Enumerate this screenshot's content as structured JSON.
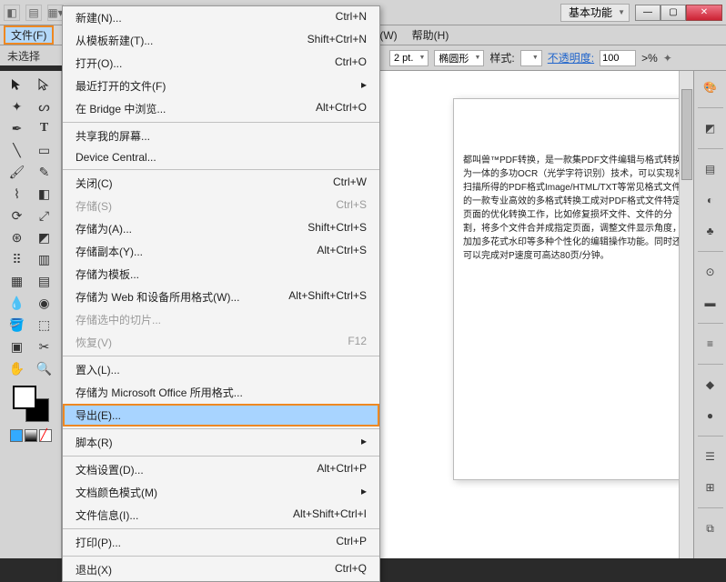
{
  "toprow": {
    "workspace": "基本功能"
  },
  "menubar": {
    "file": "文件(F)",
    "window": "(W)",
    "help": "帮助(H)"
  },
  "no_selection": "未选择",
  "ctrlbar": {
    "stroke_val": "2 pt.",
    "stroke_style": "椭圆形",
    "style_label": "样式:",
    "opacity_label": "不透明度:",
    "opacity_val": "100",
    "pct": ">%"
  },
  "menu": {
    "new": "新建(N)...",
    "new_sc": "Ctrl+N",
    "new_tpl": "从模板新建(T)...",
    "new_tpl_sc": "Shift+Ctrl+N",
    "open": "打开(O)...",
    "open_sc": "Ctrl+O",
    "recent": "最近打开的文件(F)",
    "bridge": "在 Bridge 中浏览...",
    "bridge_sc": "Alt+Ctrl+O",
    "share": "共享我的屏幕...",
    "device": "Device Central...",
    "close": "关闭(C)",
    "close_sc": "Ctrl+W",
    "save": "存储(S)",
    "save_sc": "Ctrl+S",
    "saveas": "存储为(A)...",
    "saveas_sc": "Shift+Ctrl+S",
    "savecopy": "存储副本(Y)...",
    "savecopy_sc": "Alt+Ctrl+S",
    "savetpl": "存储为模板...",
    "saveweb": "存储为 Web 和设备所用格式(W)...",
    "saveweb_sc": "Alt+Shift+Ctrl+S",
    "saveslice": "存储选中的切片...",
    "revert": "恢复(V)",
    "revert_sc": "F12",
    "place": "置入(L)...",
    "savemso": "存储为 Microsoft Office 所用格式...",
    "export": "导出(E)...",
    "scripts": "脚本(R)",
    "docsetup": "文档设置(D)...",
    "docsetup_sc": "Alt+Ctrl+P",
    "colormode": "文档颜色模式(M)",
    "fileinfo": "文件信息(I)...",
    "fileinfo_sc": "Alt+Shift+Ctrl+I",
    "print": "打印(P)...",
    "print_sc": "Ctrl+P",
    "exit": "退出(X)",
    "exit_sc": "Ctrl+Q"
  },
  "doc_text": "都叫兽™PDF转换，是一款集PDF文件编辑与格式转换为一体的多功OCR（光学字符识别）技术，可以实现将扫描所得的PDF格式Image/HTML/TXT等常见格式文件的一款专业高效的多格式转换工成对PDF格式文件特定页面的优化转换工作，比如修复损坏文件、文件的分割，将多个文件合并成指定页面，调整文件显示角度，加加多花式水印等多种个性化的编辑操作功能。同时还可以完成对P速度可高达80页/分钟。"
}
